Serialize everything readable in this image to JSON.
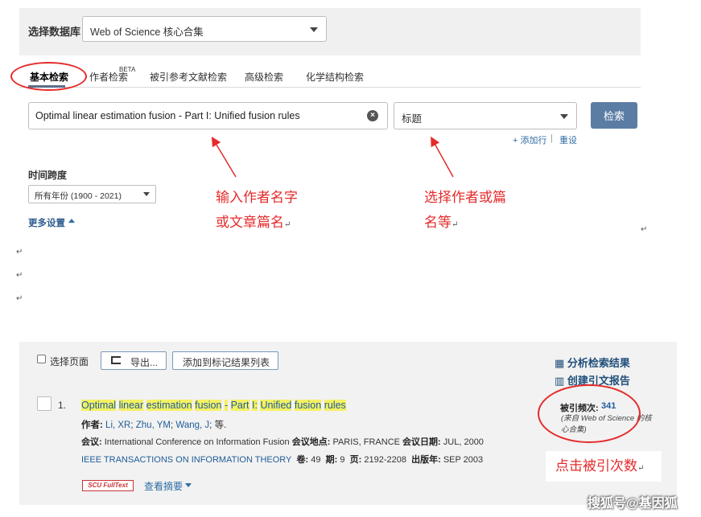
{
  "database": {
    "label": "选择数据库",
    "selected": "Web of Science 核心合集"
  },
  "tabs": {
    "basic": "基本检索",
    "author": "作者检索",
    "author_sup": "BETA",
    "cited_ref": "被引参考文献检索",
    "advanced": "高级检索",
    "chemical": "化学结构检索"
  },
  "search": {
    "query": "Optimal linear estimation fusion - Part I: Unified fusion rules",
    "field": "标题",
    "button": "检索",
    "add_row": "+ 添加行",
    "separator": "|",
    "reset": "重设"
  },
  "timespan": {
    "label": "时间跨度",
    "value": "所有年份 (1900 - 2021)",
    "more_settings": "更多设置"
  },
  "annotations": {
    "author_line1": "输入作者名字",
    "author_line2": "或文章篇名",
    "field_line1": "选择作者或篇",
    "field_line2": "名等",
    "cited": "点击被引次数",
    "para": "↵"
  },
  "results": {
    "select_page": "选择页面",
    "export": "导出...",
    "add_to_marked": "添加到标记结果列表",
    "analyze": "分析检索结果",
    "citation_report": "创建引文报告"
  },
  "record": {
    "number": "1.",
    "title_parts": [
      "Optimal",
      "linear",
      "estimation",
      "fusion",
      "-",
      "Part",
      "I:",
      "Unified",
      "fusion",
      "rules"
    ],
    "authors_label": "作者:",
    "authors": [
      "Li, XR",
      "Zhu, YM",
      "Wang, J"
    ],
    "authors_suffix": "等.",
    "conf_label": "会议:",
    "conf_name": "International Conference on Information Fusion",
    "conf_loc_label": "会议地点:",
    "conf_loc": "PARIS, FRANCE",
    "conf_date_label": "会议日期:",
    "conf_date": "JUL, 2000",
    "journal": "IEEE TRANSACTIONS ON INFORMATION THEORY",
    "volume_label": "卷:",
    "volume": "49",
    "issue_label": "期:",
    "issue": "9",
    "pages_label": "页:",
    "pages": "2192-2208",
    "year_label": "出版年:",
    "year": "SEP 2003",
    "fulltext": "SCU FullText",
    "abstract": "查看摘要",
    "cited_label": "被引频次:",
    "cited_count": "341",
    "cited_source": "(来自 Web of Science 的核心合集)"
  },
  "watermark": "搜狐号@基因狐"
}
